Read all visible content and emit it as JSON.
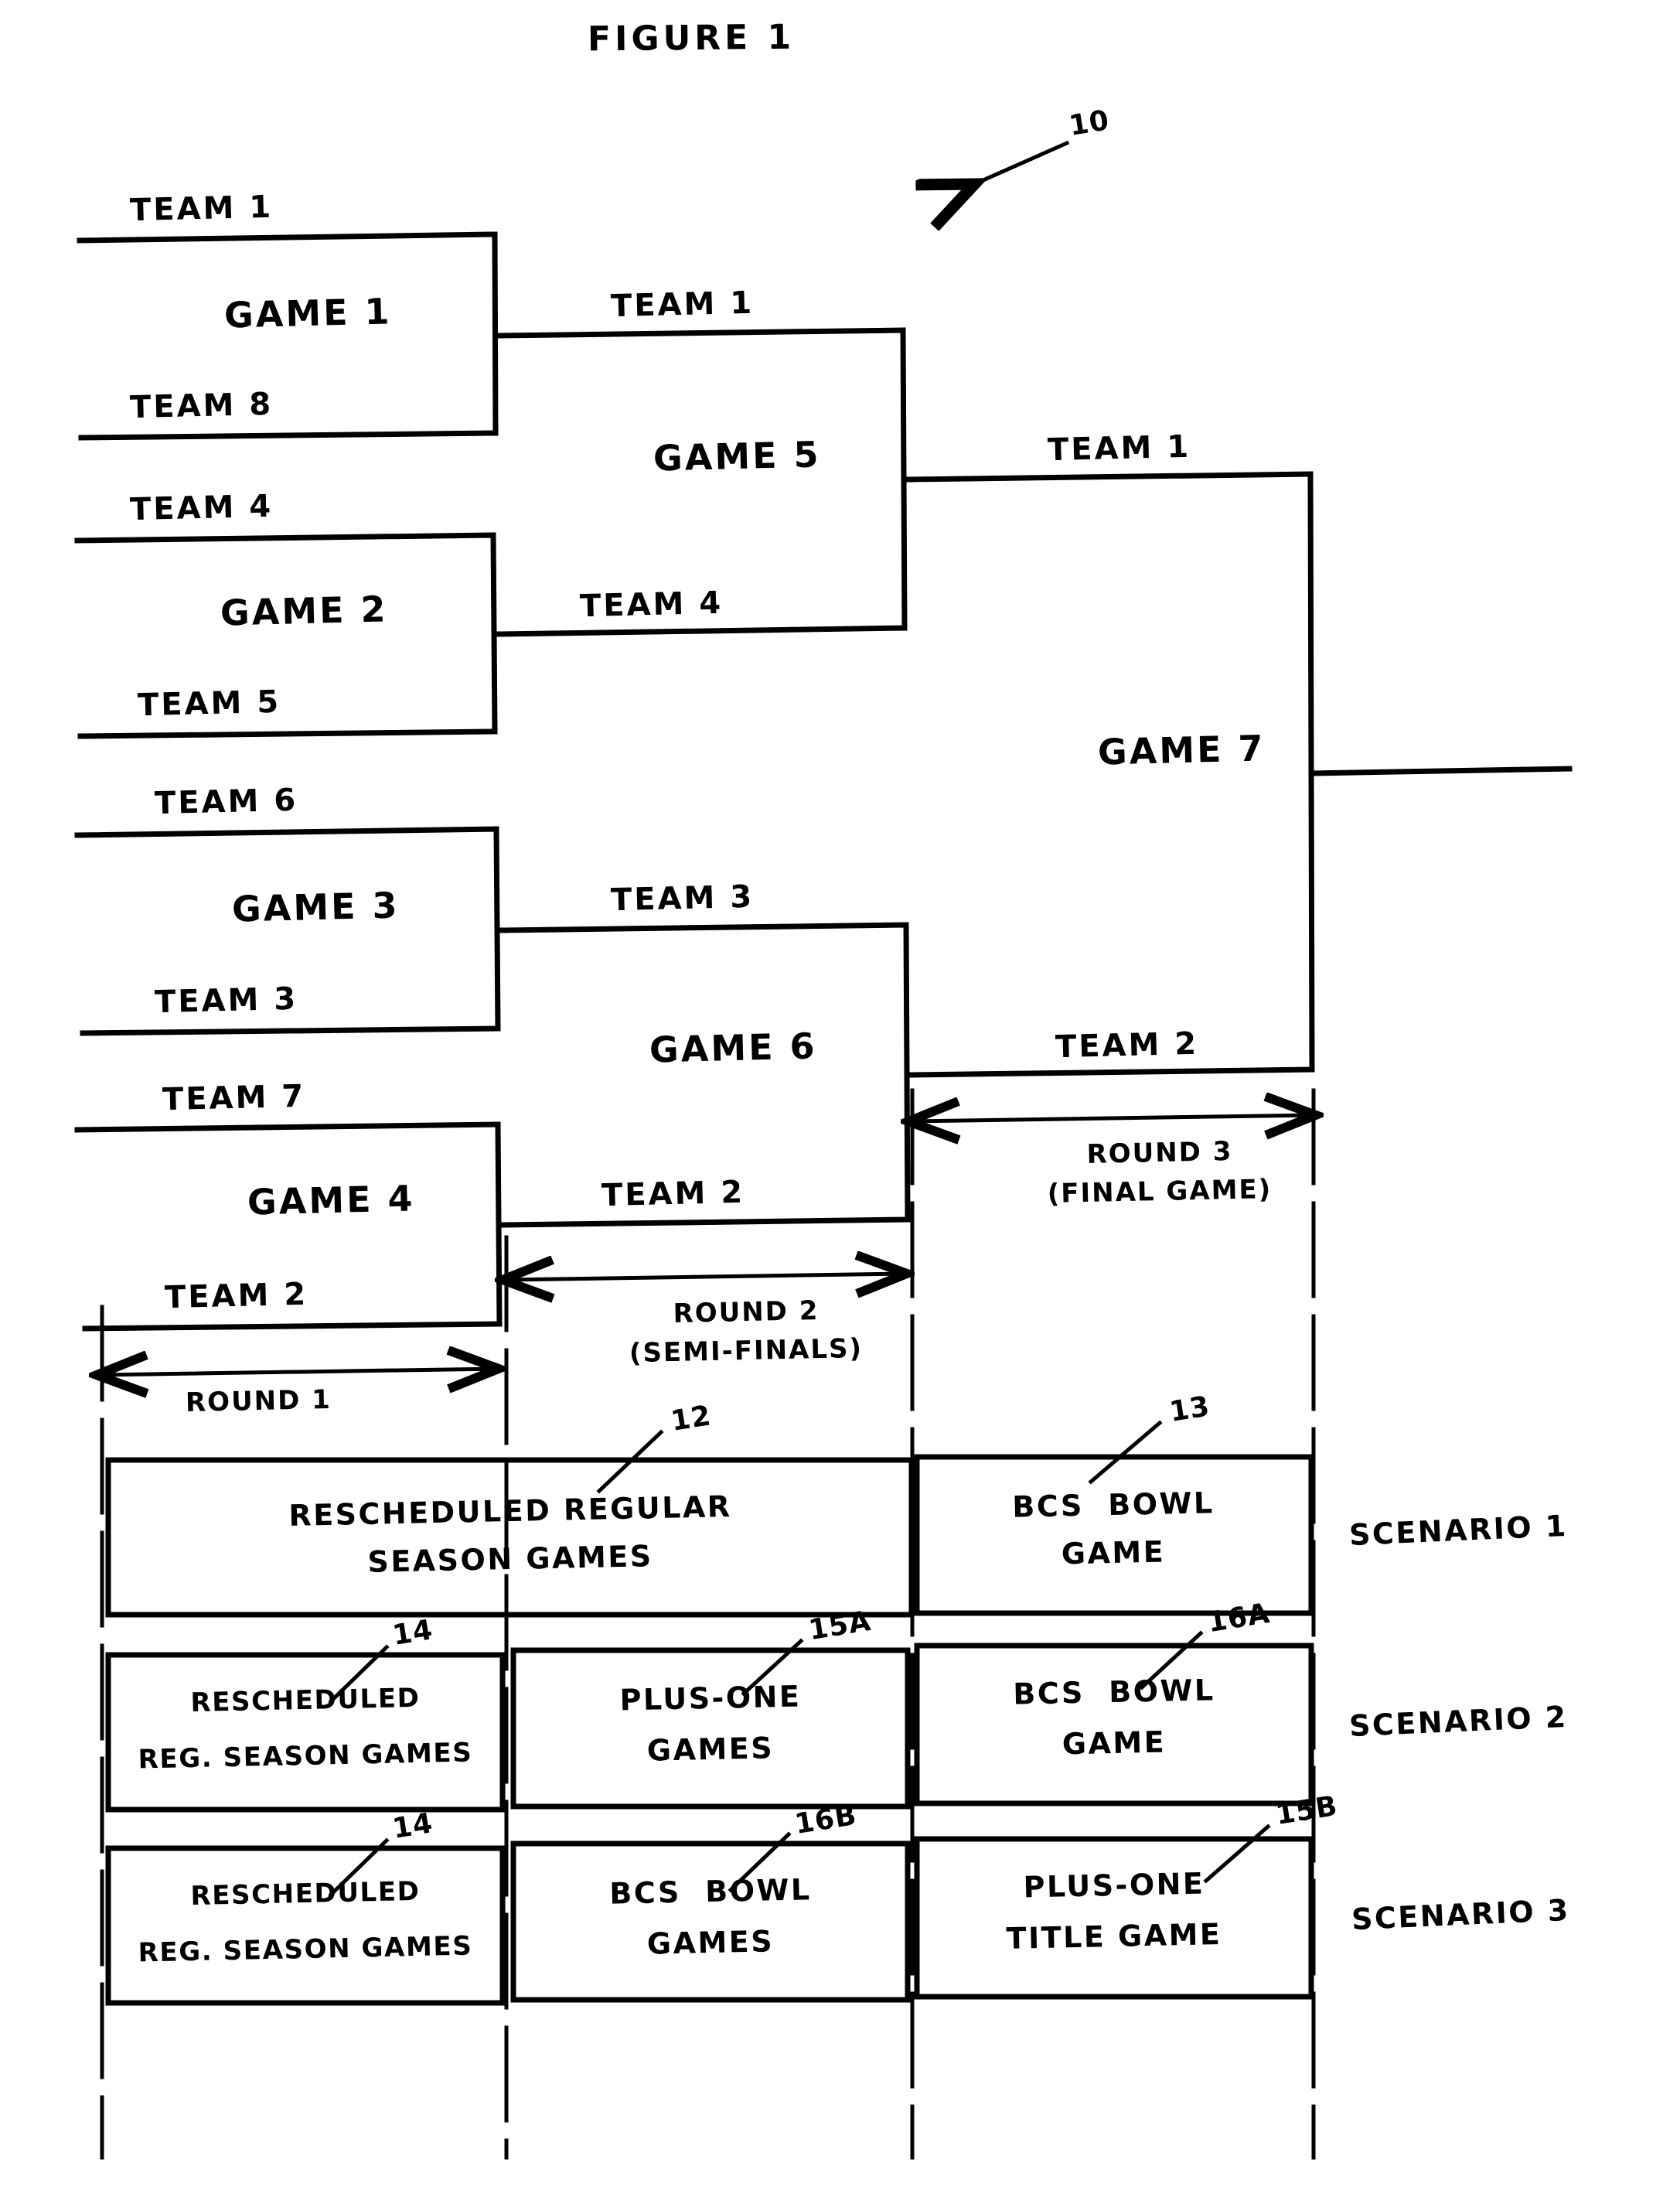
{
  "figure": {
    "title": "FIGURE 1",
    "reference_numeral": "10"
  },
  "bracket": {
    "round1": {
      "games": [
        {
          "game_label": "GAME 1",
          "top_team": "TEAM 1",
          "bottom_team": "TEAM 8"
        },
        {
          "game_label": "GAME 2",
          "top_team": "TEAM 4",
          "bottom_team": "TEAM 5"
        },
        {
          "game_label": "GAME 3",
          "top_team": "TEAM 6",
          "bottom_team": "TEAM 3"
        },
        {
          "game_label": "GAME 4",
          "top_team": "TEAM 7",
          "bottom_team": "TEAM 2"
        }
      ],
      "round_label": "ROUND 1"
    },
    "round2": {
      "games": [
        {
          "game_label": "GAME 5",
          "top_team": "TEAM 1",
          "bottom_team": "TEAM 4"
        },
        {
          "game_label": "GAME 6",
          "top_team": "TEAM 3",
          "bottom_team": "TEAM 2"
        }
      ],
      "round_label_line1": "ROUND 2",
      "round_label_line2": "(SEMI-FINALS)"
    },
    "round3": {
      "games": [
        {
          "game_label": "GAME 7",
          "top_team": "TEAM 1",
          "bottom_team": "TEAM 2"
        }
      ],
      "round_label_line1": "ROUND 3",
      "round_label_line2": "(FINAL GAME)"
    }
  },
  "scenarios": [
    {
      "name": "SCENARIO 1",
      "cells": [
        {
          "ref": "12",
          "line1": "RESCHEDULED REGULAR",
          "line2": "SEASON GAMES",
          "span": "wide"
        },
        {
          "ref": "13",
          "line1": "BCS  BOWL",
          "line2": "GAME",
          "span": "narrow"
        }
      ]
    },
    {
      "name": "SCENARIO 2",
      "cells": [
        {
          "ref": "14",
          "line1": "RESCHEDULED",
          "line2": "REG. SEASON GAMES",
          "span": "third"
        },
        {
          "ref": "15A",
          "line1": "PLUS-ONE",
          "line2": "GAMES",
          "span": "third"
        },
        {
          "ref": "16A",
          "line1": "BCS  BOWL",
          "line2": "GAME",
          "span": "third"
        }
      ]
    },
    {
      "name": "SCENARIO 3",
      "cells": [
        {
          "ref": "14",
          "line1": "RESCHEDULED",
          "line2": "REG. SEASON GAMES",
          "span": "third"
        },
        {
          "ref": "16B",
          "line1": "BCS  BOWL",
          "line2": "GAMES",
          "span": "third"
        },
        {
          "ref": "15B",
          "line1": "PLUS-ONE",
          "line2": "TITLE GAME",
          "span": "third"
        }
      ]
    }
  ],
  "colors": {
    "ink": "#000000",
    "paper": "#ffffff"
  }
}
